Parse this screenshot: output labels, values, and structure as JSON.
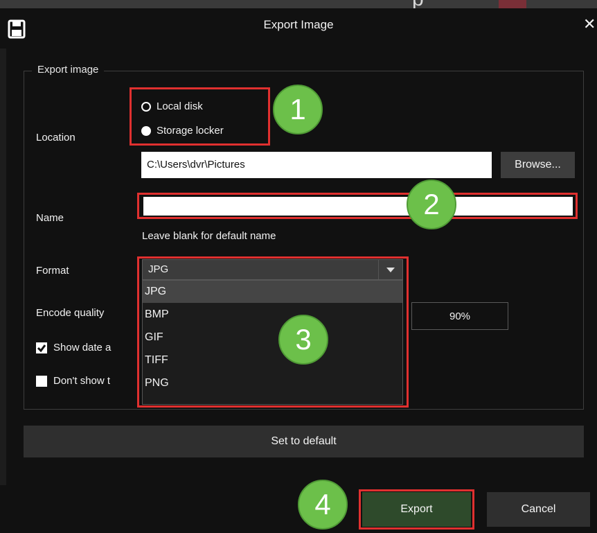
{
  "window": {
    "title": "Export Image",
    "close_glyph": "✕",
    "icon": "save-icon"
  },
  "background_fragment": "p",
  "group": {
    "legend": "Export image"
  },
  "location": {
    "label": "Location",
    "options": [
      {
        "label": "Local disk",
        "selected": false
      },
      {
        "label": "Storage locker",
        "selected": true
      }
    ],
    "path": "C:\\Users\\dvr\\Pictures",
    "browse_label": "Browse..."
  },
  "name": {
    "label": "Name",
    "value": "",
    "hint": "Leave blank for default name"
  },
  "format": {
    "label": "Format",
    "selected": "JPG",
    "options": [
      "JPG",
      "BMP",
      "GIF",
      "TIFF",
      "PNG"
    ]
  },
  "encode_quality": {
    "label": "Encode quality",
    "value": "90%"
  },
  "checkboxes": {
    "show_date": {
      "label": "Show date a",
      "checked": true
    },
    "dont_show": {
      "label": "Don't show t",
      "checked": false
    }
  },
  "buttons": {
    "set_default": "Set to default",
    "export": "Export",
    "cancel": "Cancel"
  },
  "annotations": [
    "1",
    "2",
    "3",
    "4"
  ],
  "colors": {
    "annotation_red": "#e0302f",
    "badge_green": "#6cc04a",
    "export_button": "#2e4a2b",
    "dialog_bg": "#111111"
  }
}
